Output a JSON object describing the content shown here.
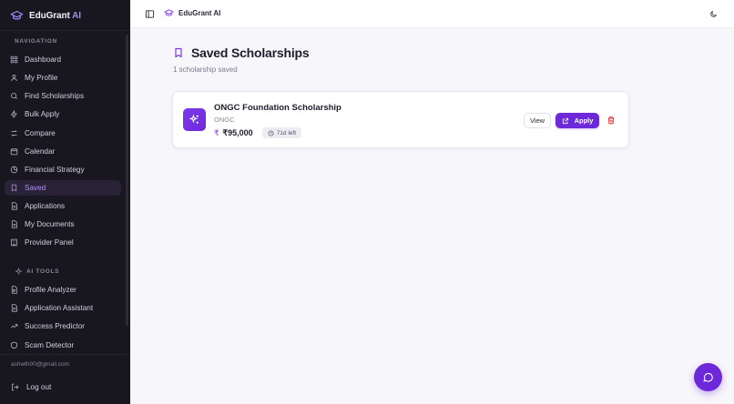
{
  "app": {
    "brand_name": "EduGrant",
    "brand_suffix": "AI",
    "header_title": "EduGrant AI"
  },
  "sidebar": {
    "nav_section_label": "NAVIGATION",
    "nav_items": [
      {
        "label": "Dashboard",
        "icon": "grid-icon"
      },
      {
        "label": "My Profile",
        "icon": "user-icon"
      },
      {
        "label": "Find Scholarships",
        "icon": "search-icon"
      },
      {
        "label": "Bulk Apply",
        "icon": "lightning-icon"
      },
      {
        "label": "Compare",
        "icon": "compare-icon"
      },
      {
        "label": "Calendar",
        "icon": "calendar-icon"
      },
      {
        "label": "Financial Strategy",
        "icon": "pie-chart-icon"
      },
      {
        "label": "Saved",
        "icon": "bookmark-icon",
        "active": true
      },
      {
        "label": "Applications",
        "icon": "document-icon"
      },
      {
        "label": "My Documents",
        "icon": "document-icon"
      },
      {
        "label": "Provider Panel",
        "icon": "building-icon"
      }
    ],
    "ai_section_label": "AI TOOLS",
    "ai_items": [
      {
        "label": "Profile Analyzer",
        "icon": "file-search-icon"
      },
      {
        "label": "Application Assistant",
        "icon": "document-icon"
      },
      {
        "label": "Success Predictor",
        "icon": "trending-up-icon"
      },
      {
        "label": "Scam Detector",
        "icon": "shield-icon"
      }
    ],
    "user_email": "ashwth00@gmail.com",
    "logout_label": "Log out"
  },
  "main": {
    "title": "Saved Scholarships",
    "subtitle": "1 scholarship saved",
    "cards": [
      {
        "title": "ONGC Foundation Scholarship",
        "provider": "ONGC",
        "currency_symbol": "₹",
        "amount": "₹95,000",
        "deadline": "71d left",
        "view_label": "View",
        "apply_label": "Apply"
      }
    ]
  },
  "colors": {
    "accent": "#6d28d9",
    "sidebar_bg": "#18161f",
    "active_text": "#b08cff",
    "delete": "#dc2626"
  }
}
